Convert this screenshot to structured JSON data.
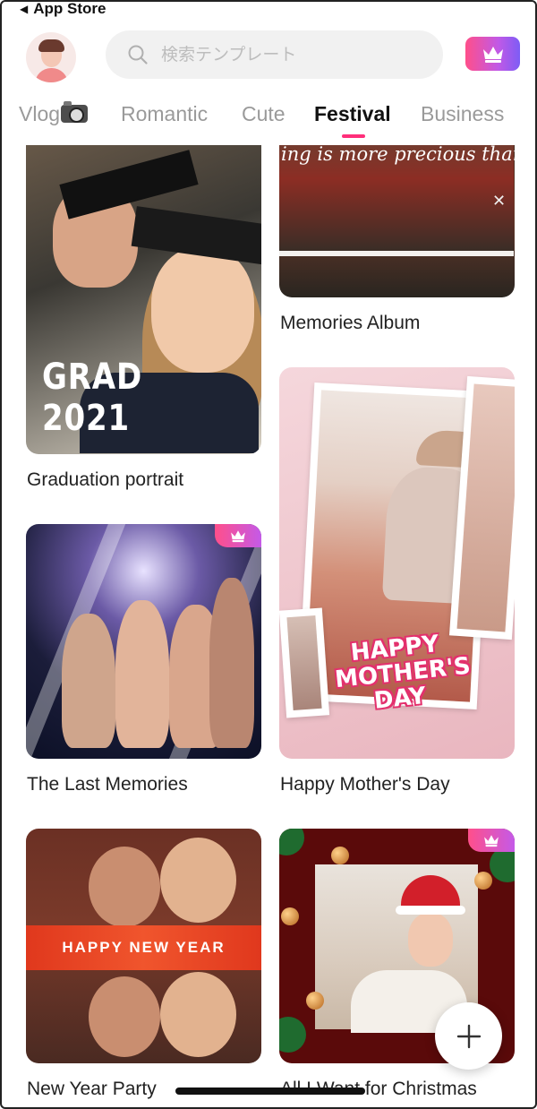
{
  "status": {
    "back_label": "App Store"
  },
  "header": {
    "search_placeholder": "検索テンプレート"
  },
  "tabs": [
    {
      "label": "Vlog",
      "active": false
    },
    {
      "label": "Romantic",
      "active": false
    },
    {
      "label": "Cute",
      "active": false
    },
    {
      "label": "Festival",
      "active": true
    },
    {
      "label": "Business",
      "active": false
    }
  ],
  "templates": {
    "graduation": {
      "title": "Graduation portrait",
      "art_text": "GRAD 2021",
      "premium": false
    },
    "memories_album": {
      "title": "Memories Album",
      "art_text": "ing is more precious than f",
      "premium": false
    },
    "mothers_day": {
      "title": "Happy Mother's Day",
      "art_text": "HAPPY MOTHER'S DAY",
      "premium": false
    },
    "last_memories": {
      "title": "The Last Memories",
      "premium": true
    },
    "new_year": {
      "title": "New Year Party",
      "art_text": "HAPPY NEW YEAR",
      "premium": false
    },
    "christmas": {
      "title": "All I Want for Christmas",
      "premium": true
    }
  },
  "colors": {
    "accent": "#ff2e7a",
    "premium_gradient_start": "#ff4f8a",
    "premium_gradient_end": "#7d5cf5"
  },
  "icons": {
    "search": "search-icon",
    "crown": "crown-icon",
    "plus": "plus-icon",
    "camera": "camera-icon",
    "back": "back-arrow-icon"
  }
}
